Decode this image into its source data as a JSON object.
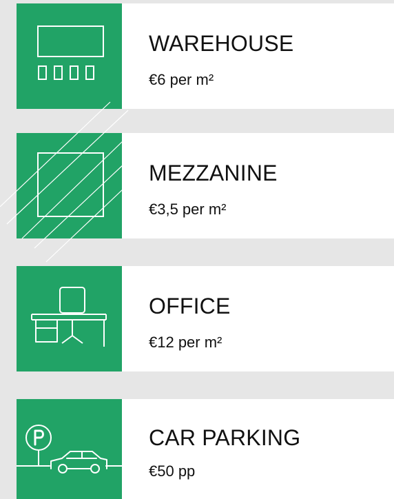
{
  "items": [
    {
      "title": "WAREHOUSE",
      "price": "€6 per m²",
      "icon": "warehouse-icon"
    },
    {
      "title": "MEZZANINE",
      "price": "€3,5 per m²",
      "icon": "mezzanine-icon"
    },
    {
      "title": "OFFICE",
      "price": "€12 per m²",
      "icon": "office-desk-icon"
    },
    {
      "title": "CAR PARKING",
      "price": "€50 pp",
      "icon": "car-parking-icon"
    }
  ],
  "colors": {
    "accent": "#21a366",
    "background": "#e6e6e6",
    "card": "#ffffff",
    "text": "#111111"
  }
}
